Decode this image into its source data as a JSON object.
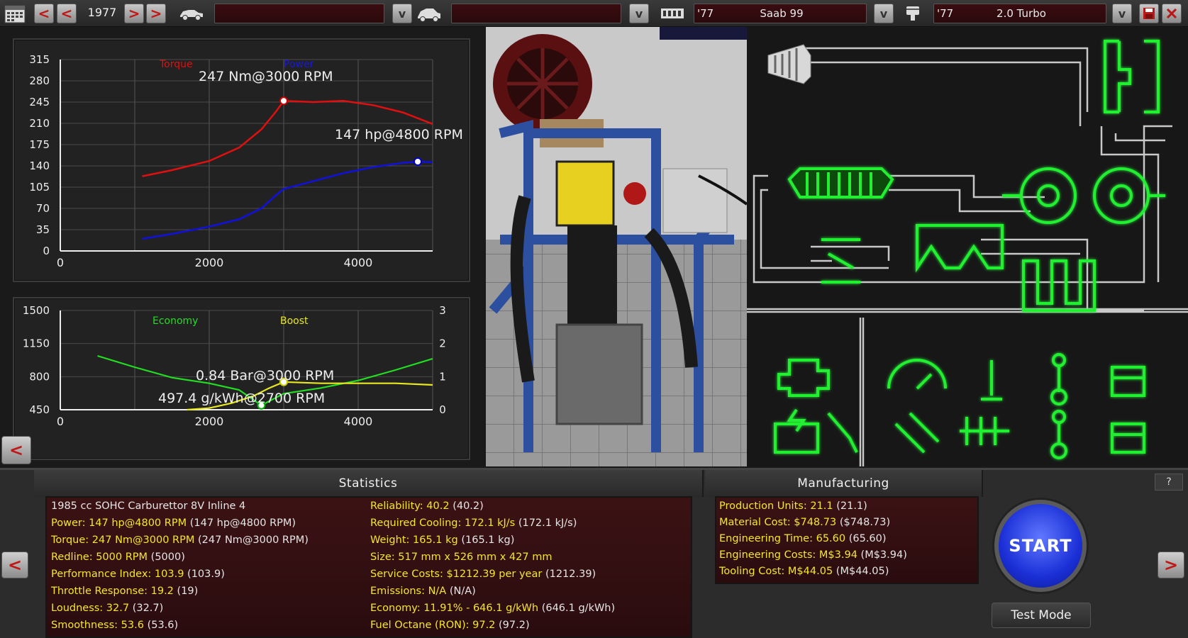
{
  "toolbar": {
    "year": "1977",
    "model_year": "'77",
    "model_name": "Saab 99",
    "engine_year": "'77",
    "engine_name": "2.0 Turbo",
    "dropdown_glyph": "v",
    "prev_glyph": "<",
    "next_glyph": ">"
  },
  "torque_chart": {
    "torque_legend": "Torque",
    "power_legend": "Power",
    "torque_peak": "247 Nm@3000 RPM",
    "power_peak": "147 hp@4800 RPM",
    "y_ticks": [
      "315",
      "280",
      "245",
      "210",
      "175",
      "140",
      "105",
      "70",
      "35",
      "0"
    ],
    "x_ticks": [
      "0",
      "2000",
      "4000"
    ]
  },
  "economy_chart": {
    "economy_legend": "Economy",
    "boost_legend": "Boost",
    "boost_peak": "0.84 Bar@3000 RPM",
    "economy_peak": "497.4 g/kWh@2700 RPM",
    "y_ticks_left": [
      "1500",
      "1150",
      "800",
      "450"
    ],
    "y_ticks_right": [
      "3",
      "2",
      "1",
      "0"
    ],
    "x_ticks": [
      "0",
      "2000",
      "4000"
    ]
  },
  "chart_data": [
    {
      "type": "line",
      "xlim": [
        0,
        5000
      ],
      "ylim": [
        0,
        315
      ],
      "series": [
        {
          "name": "Torque",
          "color": "#e01010",
          "x": [
            1100,
            1500,
            2000,
            2400,
            2700,
            2900,
            3000,
            3400,
            3800,
            4200,
            4600,
            5000
          ],
          "y": [
            123,
            133,
            148,
            170,
            200,
            230,
            247,
            245,
            247,
            240,
            228,
            209
          ]
        },
        {
          "name": "Power",
          "color": "#1010e0",
          "x": [
            1100,
            1500,
            2000,
            2400,
            2700,
            2900,
            3000,
            3400,
            3800,
            4200,
            4600,
            4800,
            5000
          ],
          "y": [
            20,
            28,
            40,
            52,
            70,
            92,
            102,
            115,
            128,
            138,
            145,
            147,
            146
          ]
        }
      ],
      "annotations": [
        "247 Nm@3000 RPM",
        "147 hp@4800 RPM"
      ]
    },
    {
      "type": "line",
      "xlim": [
        0,
        5000
      ],
      "ylim_left": [
        450,
        1500
      ],
      "ylim_right": [
        0,
        3
      ],
      "series": [
        {
          "name": "Economy",
          "color": "#22dd22",
          "axis": "left",
          "x": [
            500,
            1000,
            1500,
            2000,
            2400,
            2700,
            3000,
            3500,
            4000,
            4500,
            5000
          ],
          "y": [
            1020,
            900,
            790,
            730,
            660,
            497,
            620,
            680,
            760,
            870,
            990
          ]
        },
        {
          "name": "Boost",
          "color": "#e8e820",
          "axis": "right",
          "x": [
            1700,
            2000,
            2300,
            2600,
            2800,
            3000,
            3500,
            4000,
            4500,
            5000
          ],
          "y": [
            0,
            0.05,
            0.2,
            0.42,
            0.65,
            0.84,
            0.8,
            0.8,
            0.8,
            0.75
          ]
        }
      ],
      "annotations": [
        "0.84 Bar@3000 RPM",
        "497.4 g/kWh@2700 RPM"
      ]
    }
  ],
  "statistics": {
    "header": "Statistics",
    "left": [
      {
        "k": "1985 cc SOHC Carburettor 8V Inline 4",
        "v": "",
        "white": true
      },
      {
        "k": "Power: 147 hp@4800 RPM",
        "v": "(147 hp@4800 RPM)"
      },
      {
        "k": "Torque: 247 Nm@3000 RPM",
        "v": "(247 Nm@3000 RPM)"
      },
      {
        "k": "Redline: 5000 RPM",
        "v": "(5000)"
      },
      {
        "k": "Performance Index: 103.9",
        "v": "(103.9)"
      },
      {
        "k": "Throttle Response: 19.2",
        "v": "(19)"
      },
      {
        "k": "Loudness: 32.7",
        "v": "(32.7)"
      },
      {
        "k": "Smoothness: 53.6",
        "v": "(53.6)"
      }
    ],
    "right": [
      {
        "k": "Reliability: 40.2",
        "v": "(40.2)"
      },
      {
        "k": "Required Cooling: 172.1 kJ/s",
        "v": "(172.1 kJ/s)"
      },
      {
        "k": "Weight: 165.1 kg",
        "v": "(165.1 kg)"
      },
      {
        "k": "Size: 517 mm x 526 mm x 427 mm",
        "v": ""
      },
      {
        "k": "Service Costs: $1212.39 per year",
        "v": "(1212.39)"
      },
      {
        "k": "Emissions: N/A",
        "v": "(N/A)"
      },
      {
        "k": "Economy: 11.91% - 646.1 g/kWh",
        "v": "(646.1 g/kWh)"
      },
      {
        "k": "Fuel Octane (RON): 97.2",
        "v": "(97.2)"
      }
    ]
  },
  "manufacturing": {
    "header": "Manufacturing",
    "rows": [
      {
        "k": "Production Units: 21.1",
        "v": "(21.1)"
      },
      {
        "k": "Material Cost: $748.73",
        "v": "($748.73)"
      },
      {
        "k": "Engineering Time: 65.60",
        "v": "(65.60)"
      },
      {
        "k": "Engineering Costs: M$3.94",
        "v": "(M$3.94)"
      },
      {
        "k": "Tooling Cost: M$44.05",
        "v": "(M$44.05)"
      }
    ]
  },
  "actions": {
    "start": "START",
    "test_mode": "Test Mode",
    "help": "?"
  }
}
